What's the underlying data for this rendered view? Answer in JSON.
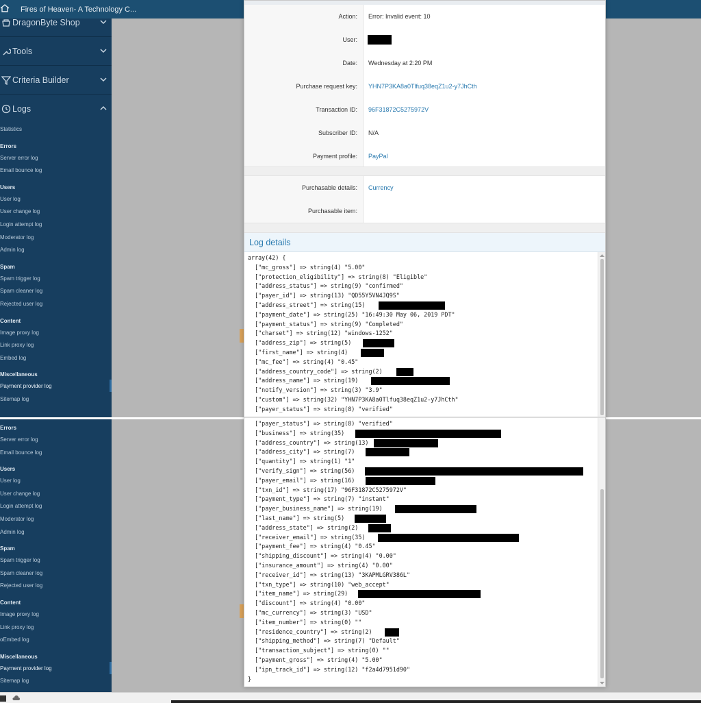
{
  "window": {
    "site_title": "Fires of Heaven- A Technology C..."
  },
  "sidebar": {
    "sections": [
      {
        "label": "DragonByte Shop",
        "icon": "shop-icon"
      },
      {
        "label": "Tools",
        "icon": "wrench-icon"
      },
      {
        "label": "Criteria Builder",
        "icon": "filter-icon"
      },
      {
        "label": "Logs",
        "icon": "clock-icon"
      }
    ],
    "top_items": [
      {
        "text": "Statistics",
        "type": "link"
      },
      {
        "text": "Errors",
        "type": "group"
      },
      {
        "text": "Server error log",
        "type": "link"
      },
      {
        "text": "Email bounce log",
        "type": "link"
      },
      {
        "text": "Users",
        "type": "group"
      },
      {
        "text": "User log",
        "type": "link"
      },
      {
        "text": "User change log",
        "type": "link"
      },
      {
        "text": "Login attempt log",
        "type": "link"
      },
      {
        "text": "Moderator log",
        "type": "link"
      },
      {
        "text": "Admin log",
        "type": "link"
      },
      {
        "text": "Spam",
        "type": "group"
      },
      {
        "text": "Spam trigger log",
        "type": "link"
      },
      {
        "text": "Spam cleaner log",
        "type": "link"
      },
      {
        "text": "Rejected user log",
        "type": "link"
      },
      {
        "text": "Content",
        "type": "group"
      },
      {
        "text": "Image proxy log",
        "type": "link"
      },
      {
        "text": "Link proxy log",
        "type": "link"
      },
      {
        "text": "Embed log",
        "type": "link"
      },
      {
        "text": "Miscellaneous",
        "type": "group"
      },
      {
        "text": "Payment provider log",
        "type": "link",
        "active": true
      },
      {
        "text": "Sitemap log",
        "type": "link"
      }
    ],
    "bottom_items": [
      {
        "text": "Errors",
        "type": "group"
      },
      {
        "text": "Server error log",
        "type": "link"
      },
      {
        "text": "Email bounce log",
        "type": "link"
      },
      {
        "text": "Users",
        "type": "group"
      },
      {
        "text": "User log",
        "type": "link"
      },
      {
        "text": "User change log",
        "type": "link"
      },
      {
        "text": "Login attempt log",
        "type": "link"
      },
      {
        "text": "Moderator log",
        "type": "link"
      },
      {
        "text": "Admin log",
        "type": "link"
      },
      {
        "text": "Spam",
        "type": "group"
      },
      {
        "text": "Spam trigger log",
        "type": "link"
      },
      {
        "text": "Spam cleaner log",
        "type": "link"
      },
      {
        "text": "Rejected user log",
        "type": "link"
      },
      {
        "text": "Content",
        "type": "group"
      },
      {
        "text": "Image proxy log",
        "type": "link"
      },
      {
        "text": "Link proxy log",
        "type": "link"
      },
      {
        "text": "oEmbed log",
        "type": "link"
      },
      {
        "text": "Miscellaneous",
        "type": "group"
      },
      {
        "text": "Payment provider log",
        "type": "link",
        "active": true
      },
      {
        "text": "Sitemap log",
        "type": "link"
      }
    ]
  },
  "details": {
    "rows": [
      {
        "label": "Action:",
        "value": "Error: Invalid event: 10",
        "link": false
      },
      {
        "label": "User:",
        "value": "",
        "redacted": true
      },
      {
        "label": "Date:",
        "value": "Wednesday at 2:20 PM",
        "link": false
      },
      {
        "label": "Purchase request key:",
        "value": "YHN7P3KA8a0Tlfuq38eqZ1u2-y7JhCth",
        "link": true
      },
      {
        "label": "Transaction ID:",
        "value": "96F31872C5275972V",
        "link": true
      },
      {
        "label": "Subscriber ID:",
        "value": "N/A",
        "link": false
      },
      {
        "label": "Payment profile:",
        "value": "PayPal",
        "link": true
      }
    ],
    "purchasable_rows": [
      {
        "label": "Purchasable details:",
        "value": "Currency",
        "link": true
      },
      {
        "label": "Purchasable item:",
        "value": "",
        "link": false
      }
    ]
  },
  "log": {
    "title": "Log details",
    "top_lines": [
      "array(42) {",
      "  [\"mc_gross\"] => string(4) \"5.00\"",
      "  [\"protection_eligibility\"] => string(8) \"Eligible\"",
      "  [\"address_status\"] => string(9) \"confirmed\"",
      "  [\"payer_id\"] => string(13) \"QD55Y5VN4JQ9S\"",
      "  [\"address_street\"] => string(15)",
      "  [\"payment_date\"] => string(25) \"16:49:30 May 06, 2019 PDT\"",
      "  [\"payment_status\"] => string(9) \"Completed\"",
      "  [\"charset\"] => string(12) \"windows-1252\"",
      "  [\"address_zip\"] => string(5)",
      "  [\"first_name\"] => string(4)",
      "  [\"mc_fee\"] => string(4) \"0.45\"",
      "  [\"address_country_code\"] => string(2)",
      "  [\"address_name\"] => string(19)",
      "  [\"notify_version\"] => string(3) \"3.9\"",
      "  [\"custom\"] => string(32) \"YHN7P3KA8a0Tlfuq38eqZ1u2-y7JhCth\"",
      "  [\"payer_status\"] => string(8) \"verified\""
    ],
    "bottom_lines": [
      "  [\"payer_status\"] => string(8) \"verified\"",
      "  [\"business\"] => string(35)",
      "  [\"address_country\"] => string(13)",
      "  [\"address_city\"] => string(7)",
      "  [\"quantity\"] => string(1) \"1\"",
      "  [\"verify_sign\"] => string(56)",
      "  [\"payer_email\"] => string(16)",
      "  [\"txn_id\"] => string(17) \"96F31872C5275972V\"",
      "  [\"payment_type\"] => string(7) \"instant\"",
      "  [\"payer_business_name\"] => string(19)",
      "  [\"last_name\"] => string(5)",
      "  [\"address_state\"] => string(2)",
      "  [\"receiver_email\"] => string(35)",
      "  [\"payment_fee\"] => string(4) \"0.45\"",
      "  [\"shipping_discount\"] => string(4) \"0.00\"",
      "  [\"insurance_amount\"] => string(4) \"0.00\"",
      "  [\"receiver_id\"] => string(13) \"3KAPMLGRV386L\"",
      "  [\"txn_type\"] => string(10) \"web_accept\"",
      "  [\"item_name\"] => string(29)",
      "  [\"discount\"] => string(4) \"0.00\"",
      "  [\"mc_currency\"] => string(3) \"USD\"",
      "  [\"item_number\"] => string(0) \"\"",
      "  [\"residence_country\"] => string(2)",
      "  [\"shipping_method\"] => string(7) \"Default\"",
      "  [\"transaction_subject\"] => string(0) \"\"",
      "  [\"payment_gross\"] => string(4) \"5.00\"",
      "  [\"ipn_track_id\"] => string(12) \"f2a4d7951d90\"",
      "}"
    ]
  },
  "colors": {
    "sidebar_bg": "#173e5f",
    "topbar_bg": "#1c4f72",
    "link": "#2b7bb0",
    "redaction": "#000000"
  }
}
